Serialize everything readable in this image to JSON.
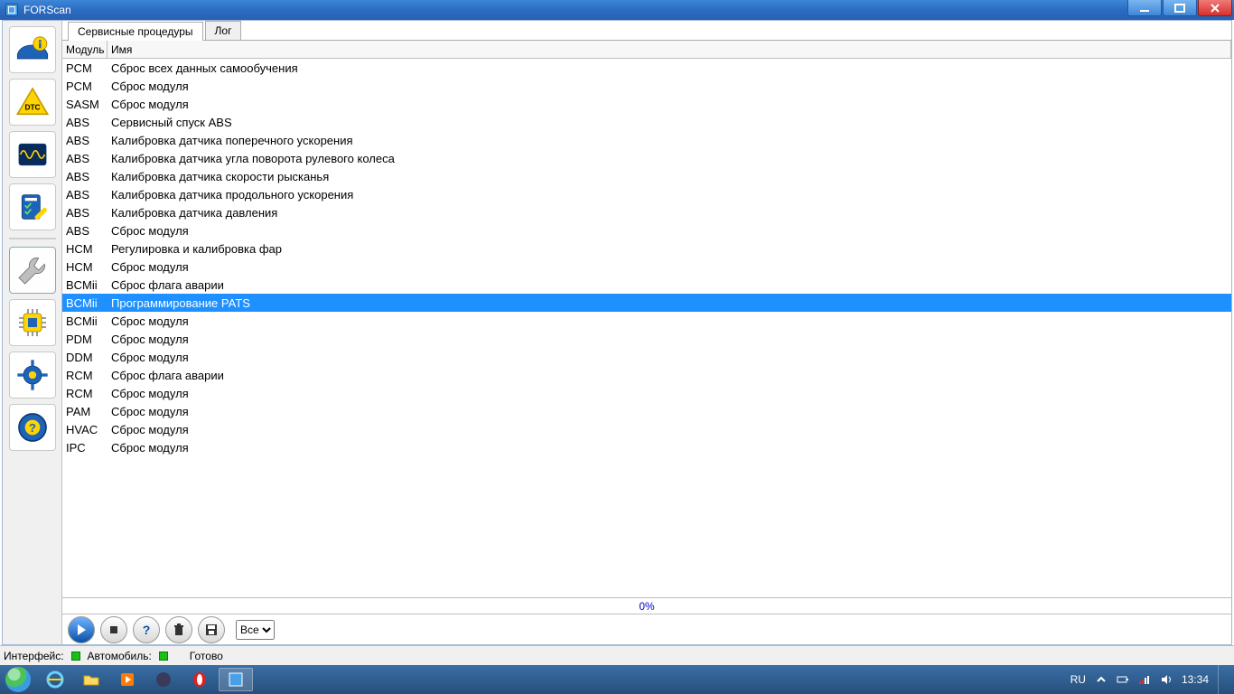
{
  "window": {
    "title": "FORScan"
  },
  "tabs": [
    {
      "label": "Сервисные процедуры",
      "active": true
    },
    {
      "label": "Лог",
      "active": false
    }
  ],
  "columns": {
    "module": "Модуль",
    "name": "Имя"
  },
  "rows": [
    {
      "module": "PCM",
      "name": "Сброс всех данных самообучения"
    },
    {
      "module": "PCM",
      "name": "Сброс модуля"
    },
    {
      "module": "SASM",
      "name": "Сброс модуля"
    },
    {
      "module": "ABS",
      "name": "Сервисный спуск ABS"
    },
    {
      "module": "ABS",
      "name": "Калибровка датчика поперечного ускорения"
    },
    {
      "module": "ABS",
      "name": "Калибровка датчика угла поворота рулевого колеса"
    },
    {
      "module": "ABS",
      "name": "Калибровка датчика скорости рысканья"
    },
    {
      "module": "ABS",
      "name": "Калибровка датчика продольного ускорения"
    },
    {
      "module": "ABS",
      "name": "Калибровка датчика давления"
    },
    {
      "module": "ABS",
      "name": "Сброс модуля"
    },
    {
      "module": "HCM",
      "name": "Регулировка и калибровка фар"
    },
    {
      "module": "HCM",
      "name": "Сброс модуля"
    },
    {
      "module": "BCMii",
      "name": "Сброс флага аварии"
    },
    {
      "module": "BCMii",
      "name": "Программирование PATS",
      "selected": true
    },
    {
      "module": "BCMii",
      "name": "Сброс модуля"
    },
    {
      "module": "PDM",
      "name": "Сброс модуля"
    },
    {
      "module": "DDM",
      "name": "Сброс модуля"
    },
    {
      "module": "RCM",
      "name": "Сброс флага аварии"
    },
    {
      "module": "RCM",
      "name": "Сброс модуля"
    },
    {
      "module": "PAM",
      "name": "Сброс модуля"
    },
    {
      "module": "HVAC",
      "name": "Сброс модуля"
    },
    {
      "module": "IPC",
      "name": "Сброс модуля"
    }
  ],
  "progress": {
    "text": "0%"
  },
  "filter": {
    "options": [
      "Все"
    ],
    "selected": "Все"
  },
  "status": {
    "interface_label": "Интерфейс:",
    "vehicle_label": "Автомобиль:",
    "ready": "Готово"
  },
  "tray": {
    "lang": "RU",
    "time": "13:34"
  }
}
